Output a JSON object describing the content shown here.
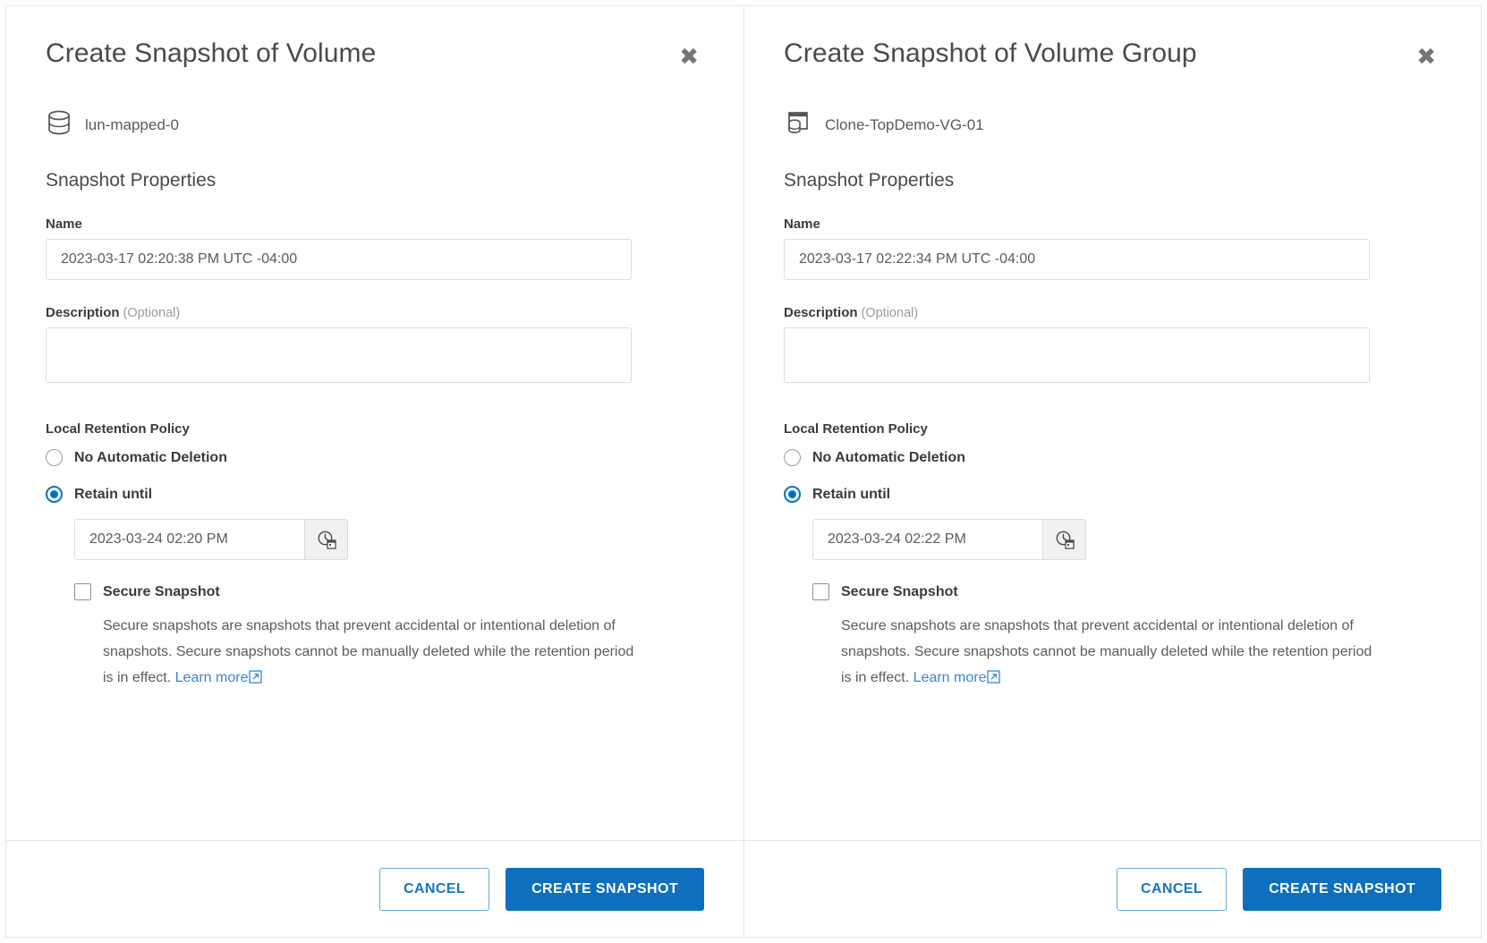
{
  "theme": {
    "accent": "#0d6fbe",
    "link": "#3b86d0",
    "radio_selected": "#0072c6",
    "text": "#3b3b3b",
    "muted": "#5c5c5c",
    "border": "#dcdcdc"
  },
  "panels": [
    {
      "title": "Create Snapshot of Volume",
      "close_label": "✖",
      "object_icon": "volume-icon",
      "object_name": "lun-mapped-0",
      "section_title": "Snapshot Properties",
      "name_label": "Name",
      "name_value": "2023-03-17 02:20:38 PM UTC -04:00",
      "name_placeholder": "",
      "description_label": "Description",
      "description_optional": "(Optional)",
      "description_value": "",
      "description_placeholder": "",
      "retention_title": "Local Retention Policy",
      "radio_no_auto_label": "No Automatic Deletion",
      "radio_no_auto_selected": false,
      "radio_retain_label": "Retain until",
      "radio_retain_selected": true,
      "retain_until_value": "2023-03-24 02:20 PM",
      "retain_until_placeholder": "",
      "datepicker_icon": "clock-calendar-icon",
      "secure_label": "Secure Snapshot",
      "secure_checked": false,
      "help_text": "Secure snapshots are snapshots that prevent accidental or intentional deletion of snapshots. Secure snapshots cannot be manually deleted while the retention period is in effect. ",
      "help_link": "Learn more",
      "cancel_label": "CANCEL",
      "submit_label": "CREATE SNAPSHOT"
    },
    {
      "title": "Create Snapshot of Volume Group",
      "close_label": "✖",
      "object_icon": "volume-group-icon",
      "object_name": "Clone-TopDemo-VG-01",
      "section_title": "Snapshot Properties",
      "name_label": "Name",
      "name_value": "2023-03-17 02:22:34 PM UTC -04:00",
      "name_placeholder": "",
      "description_label": "Description",
      "description_optional": "(Optional)",
      "description_value": "",
      "description_placeholder": "",
      "retention_title": "Local Retention Policy",
      "radio_no_auto_label": "No Automatic Deletion",
      "radio_no_auto_selected": false,
      "radio_retain_label": "Retain until",
      "radio_retain_selected": true,
      "retain_until_value": "2023-03-24 02:22 PM",
      "retain_until_placeholder": "",
      "datepicker_icon": "clock-calendar-icon",
      "secure_label": "Secure Snapshot",
      "secure_checked": false,
      "help_text": "Secure snapshots are snapshots that prevent accidental or intentional deletion of snapshots. Secure snapshots cannot be manually deleted while the retention period is in effect. ",
      "help_link": "Learn more",
      "cancel_label": "CANCEL",
      "submit_label": "CREATE SNAPSHOT"
    }
  ]
}
